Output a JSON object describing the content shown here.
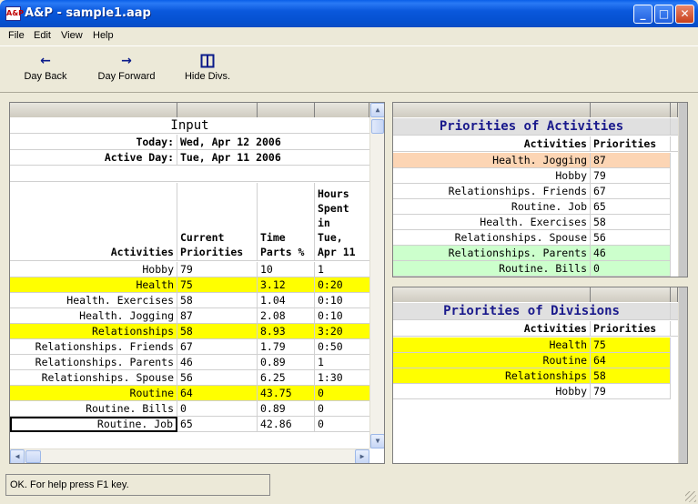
{
  "window": {
    "title": "A&P - sample1.aap",
    "icon_text": "A&P",
    "controls": {
      "minimize": "_",
      "maximize": "□",
      "close": "✕"
    }
  },
  "menu": {
    "file": "File",
    "edit": "Edit",
    "view": "View",
    "help": "Help"
  },
  "toolbar": {
    "day_back": {
      "label": "Day Back",
      "icon": "arrow-left-icon"
    },
    "day_forward": {
      "label": "Day Forward",
      "icon": "arrow-right-icon"
    },
    "hide_divs": {
      "label": "Hide Divs.",
      "icon": "split-columns-icon"
    }
  },
  "input_panel": {
    "title": "Input",
    "today_label": "Today:",
    "today_value": "Wed, Apr 12 2006",
    "active_day_label": "Active Day:",
    "active_day_value": "Tue, Apr 11 2006",
    "columns": {
      "activities": "Activities",
      "current_priorities": [
        "Current",
        "Priorities"
      ],
      "time_parts": [
        "Time",
        "Parts %"
      ],
      "hours_spent": [
        "Hours",
        "Spent",
        "in",
        "Tue,",
        "Apr 11"
      ]
    },
    "rows": [
      {
        "activity": "Hobby",
        "priority": "79",
        "time_parts": "10",
        "hours": "1",
        "highlight": "none"
      },
      {
        "activity": "Health",
        "priority": "75",
        "time_parts": "3.12",
        "hours": "0:20",
        "highlight": "yellow"
      },
      {
        "activity": "Health. Exercises",
        "priority": "58",
        "time_parts": "1.04",
        "hours": "0:10",
        "highlight": "none"
      },
      {
        "activity": "Health. Jogging",
        "priority": "87",
        "time_parts": "2.08",
        "hours": "0:10",
        "highlight": "none"
      },
      {
        "activity": "Relationships",
        "priority": "58",
        "time_parts": "8.93",
        "hours": "3:20",
        "highlight": "yellow"
      },
      {
        "activity": "Relationships. Friends",
        "priority": "67",
        "time_parts": "1.79",
        "hours": "0:50",
        "highlight": "none"
      },
      {
        "activity": "Relationships. Parents",
        "priority": "46",
        "time_parts": "0.89",
        "hours": "1",
        "highlight": "none"
      },
      {
        "activity": "Relationships. Spouse",
        "priority": "56",
        "time_parts": "6.25",
        "hours": "1:30",
        "highlight": "none"
      },
      {
        "activity": "Routine",
        "priority": "64",
        "time_parts": "43.75",
        "hours": "0",
        "highlight": "yellow"
      },
      {
        "activity": "Routine. Bills",
        "priority": "0",
        "time_parts": "0.89",
        "hours": "0",
        "highlight": "none"
      },
      {
        "activity": "Routine. Job",
        "priority": "65",
        "time_parts": "42.86",
        "hours": "0",
        "highlight": "selected"
      }
    ]
  },
  "activities_panel": {
    "title": "Priorities of Activities",
    "col_activities": "Activities",
    "col_priorities": "Priorities",
    "rows": [
      {
        "activity": "Health. Jogging",
        "priority": "87",
        "highlight": "peach"
      },
      {
        "activity": "Hobby",
        "priority": "79",
        "highlight": "none"
      },
      {
        "activity": "Relationships. Friends",
        "priority": "67",
        "highlight": "none"
      },
      {
        "activity": "Routine. Job",
        "priority": "65",
        "highlight": "none"
      },
      {
        "activity": "Health. Exercises",
        "priority": "58",
        "highlight": "none"
      },
      {
        "activity": "Relationships. Spouse",
        "priority": "56",
        "highlight": "none"
      },
      {
        "activity": "Relationships. Parents",
        "priority": "46",
        "highlight": "mint"
      },
      {
        "activity": "Routine. Bills",
        "priority": "0",
        "highlight": "mint"
      }
    ]
  },
  "divisions_panel": {
    "title": "Priorities of Divisions",
    "col_activities": "Activities",
    "col_priorities": "Priorities",
    "rows": [
      {
        "activity": "Health",
        "priority": "75",
        "highlight": "yellow"
      },
      {
        "activity": "Routine",
        "priority": "64",
        "highlight": "yellow"
      },
      {
        "activity": "Relationships",
        "priority": "58",
        "highlight": "yellow"
      },
      {
        "activity": "Hobby",
        "priority": "79",
        "highlight": "none"
      }
    ]
  },
  "statusbar": {
    "text": "OK. For help press F1 key."
  },
  "colors": {
    "title_blue": "#1a1a8c",
    "highlight_yellow": "#ffff00",
    "highlight_peach": "#fcd5b4",
    "highlight_mint": "#ccffcc"
  }
}
